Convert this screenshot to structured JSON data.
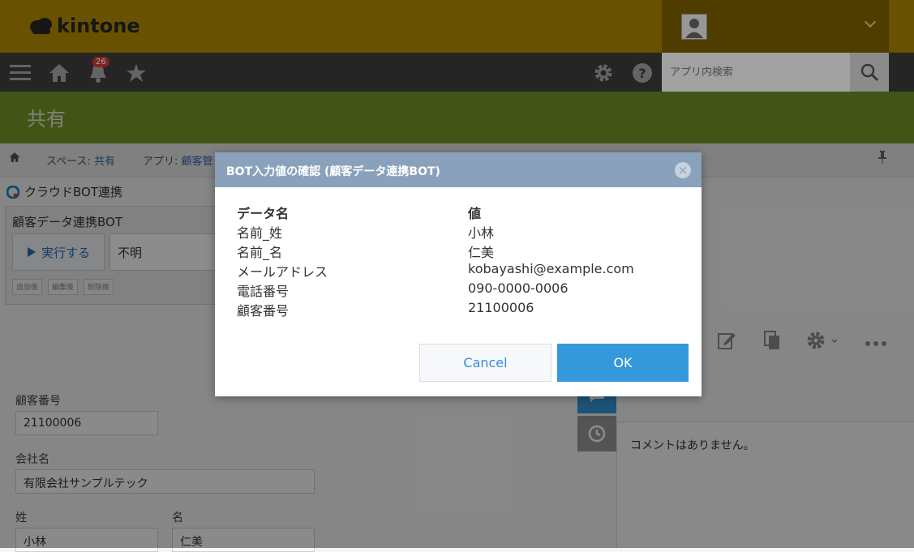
{
  "header": {
    "logo_text": "kintone",
    "notification_count": "26",
    "search_placeholder": "アプリ内検索"
  },
  "space": {
    "title": "共有"
  },
  "breadcrumb": {
    "space_prefix": "スペース: ",
    "space_name": "共有",
    "app_prefix": "アプリ: ",
    "app_name": "顧客管"
  },
  "bot_plugin": {
    "heading": "クラウドBOT連携",
    "bot_name": "顧客データ連携BOT",
    "run_label": "実行する",
    "status": "不明",
    "triggers": [
      "追加後",
      "編集後",
      "削除後"
    ]
  },
  "record": {
    "fields": [
      {
        "label": "顧客番号",
        "value": "21100006"
      },
      {
        "label": "会社名",
        "value": "有限会社サンプルテック"
      },
      {
        "label": "姓",
        "value": "小林"
      },
      {
        "label": "名",
        "value": "仁美"
      }
    ]
  },
  "comments": {
    "empty_text": "コメントはありません。"
  },
  "dialog": {
    "title": "BOT入力値の確認 (顧客データ連携BOT)",
    "col_name": "データ名",
    "col_value": "値",
    "rows": [
      {
        "name": "名前_姓",
        "value": "小林"
      },
      {
        "name": "名前_名",
        "value": "仁美"
      },
      {
        "name": "メールアドレス",
        "value": "kobayashi@example.com"
      },
      {
        "name": "電話番号",
        "value": "090-0000-0006"
      },
      {
        "name": "顧客番号",
        "value": "21100006"
      }
    ],
    "cancel_label": "Cancel",
    "ok_label": "OK"
  },
  "colors": {
    "header_bg": "#a07d00",
    "nav_bg": "#3a3a3a",
    "space_bg": "#7a9a2a",
    "dialog_head": "#8aa1bc",
    "ok_button": "#3498db"
  }
}
